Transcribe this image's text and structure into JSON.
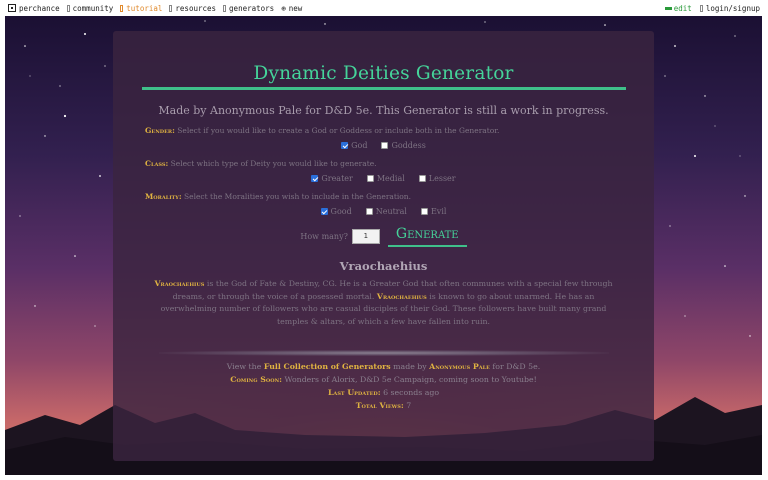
{
  "nav": {
    "site": "perchance",
    "community": "community",
    "tutorial": "tutorial",
    "resources": "resources",
    "generators": "generators",
    "new": "new",
    "edit": "edit",
    "login": "login/signup"
  },
  "generator": {
    "title": "Dynamic Deities Generator",
    "credit": "Made by Anonymous Pale for D&D 5e. This Generator is still a work in progress.",
    "gender": {
      "label": "Gender:",
      "text": " Select if you would like to create a God or Goddess or include both in the Generator.",
      "options": [
        {
          "label": "God",
          "checked": true
        },
        {
          "label": "Goddess",
          "checked": false
        }
      ]
    },
    "class": {
      "label": "Class:",
      "text": " Select which type of Deity you would like to generate.",
      "options": [
        {
          "label": "Greater",
          "checked": true
        },
        {
          "label": "Medial",
          "checked": false
        },
        {
          "label": "Lesser",
          "checked": false
        }
      ]
    },
    "morality": {
      "label": "Morality:",
      "text": " Select the Moralities you wish to include in the Generation.",
      "options": [
        {
          "label": "Good",
          "checked": true
        },
        {
          "label": "Neutral",
          "checked": false
        },
        {
          "label": "Evil",
          "checked": false
        }
      ]
    },
    "how_many_label": "How many?",
    "how_many_value": "1",
    "generate_label": "Generate"
  },
  "result": {
    "name": "Vraochaehius",
    "name_inline": "Vraochaehius",
    "part1": " is the God of Fate & Destiny, CG. He is a Greater God that often communes with a special few through dreams, or through the voice of a posessed mortal. ",
    "part2": " is known to go about unarmed. He has an overwhelming number of followers who are casual disciples of their God. These followers have built many grand temples & altars, of which a few have fallen into ruin."
  },
  "footer": {
    "view_prefix": "View the ",
    "collection_link": "Full Collection of Generators",
    "made_by": " made by ",
    "author": "Anonymous Pale",
    "for": " for D&D 5e.",
    "coming_label": "Coming Soon:",
    "coming_text": " Wonders of Alorix, D&D 5e Campaign, coming soon to Youtube!",
    "updated_label": "Last Updated:",
    "updated_value": " 6 seconds ago",
    "views_label": "Total Views:",
    "views_value": " 7"
  }
}
